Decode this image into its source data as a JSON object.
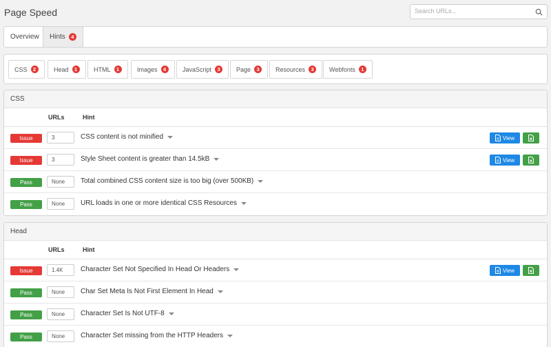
{
  "app": {
    "title": "Page Speed"
  },
  "search": {
    "placeholder": "Search URLs..."
  },
  "main_tabs": [
    {
      "label": "Overview",
      "active": false
    },
    {
      "label": "Hints",
      "badge": "4",
      "active": true
    }
  ],
  "filters": [
    {
      "label": "CSS",
      "count": "2"
    },
    {
      "label": "Head",
      "count": "1"
    },
    {
      "label": "HTML",
      "count": "1"
    },
    {
      "label": "Images",
      "count": "4"
    },
    {
      "label": "JavaScript",
      "count": "3"
    },
    {
      "label": "Page",
      "count": "3"
    },
    {
      "label": "Resources",
      "count": "3"
    },
    {
      "label": "Webfonts",
      "count": "1"
    }
  ],
  "columns": {
    "urls": "URLs",
    "hint": "Hint"
  },
  "buttons": {
    "view": "View"
  },
  "sections": [
    {
      "title": "CSS",
      "rows": [
        {
          "status": "Issue",
          "urls": "3",
          "hint": "CSS content is not minified"
        },
        {
          "status": "Issue",
          "urls": "3",
          "hint": "Style Sheet content is greater than 14.5kB"
        },
        {
          "status": "Pass",
          "urls": "None",
          "hint": "Total combined CSS content size is too big (over 500KB)"
        },
        {
          "status": "Pass",
          "urls": "None",
          "hint": "URL loads in one or more identical CSS Resources"
        }
      ]
    },
    {
      "title": "Head",
      "rows": [
        {
          "status": "Issue",
          "urls": "1.4K",
          "hint": "Character Set Not Specified In Head Or Headers"
        },
        {
          "status": "Pass",
          "urls": "None",
          "hint": "Char Set Meta Is Not First Element In Head"
        },
        {
          "status": "Pass",
          "urls": "None",
          "hint": "Character Set Is Not UTF-8"
        },
        {
          "status": "Pass",
          "urls": "None",
          "hint": "Character Set missing from the HTTP Headers"
        }
      ]
    }
  ],
  "colors": {
    "issue": "#e53935",
    "pass": "#43a047",
    "view": "#1e88e5",
    "badge": "#e53935"
  }
}
